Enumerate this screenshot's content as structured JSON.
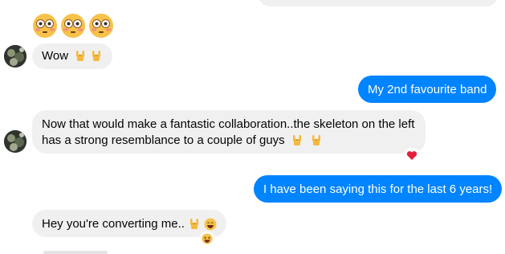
{
  "messages": [
    {
      "type": "incoming",
      "text": "Wow"
    },
    {
      "type": "outgoing",
      "text": "My 2nd favourite band"
    },
    {
      "type": "incoming",
      "text": "Now that would make a fantastic collaboration..the skeleton on the left has a strong resemblance to a couple of guys",
      "reaction": "heart-icon"
    },
    {
      "type": "outgoing",
      "text": "I have been saying this for the last 6 years!"
    },
    {
      "type": "incoming",
      "text": "Hey you're converting me..",
      "reaction": "laughing-emoji-icon"
    }
  ],
  "colors": {
    "outgoing_bubble": "#0084ff",
    "incoming_bubble": "#f0f0f0",
    "reaction_heart": "#e41e3f"
  }
}
